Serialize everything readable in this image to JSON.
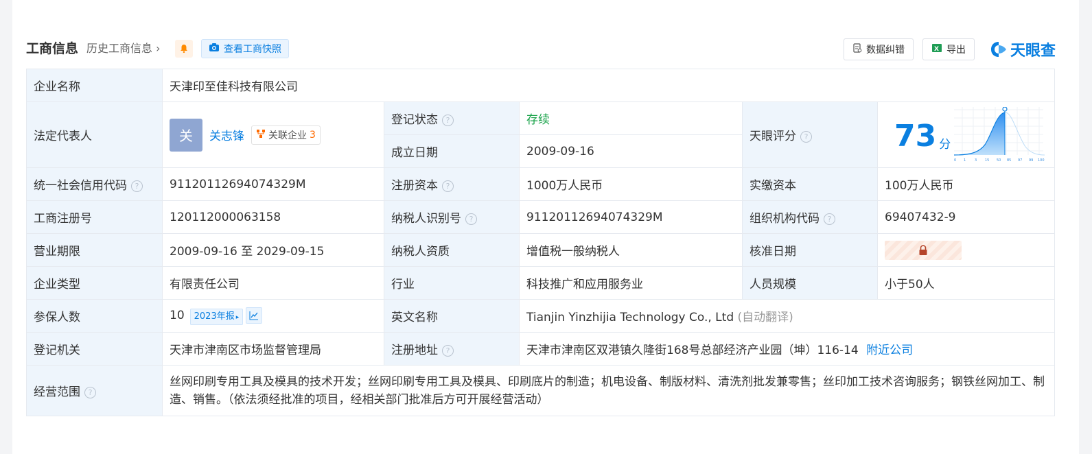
{
  "header": {
    "title": "工商信息",
    "history_link": "历史工商信息",
    "snapshot_button": "查看工商快照",
    "error_button": "数据纠错",
    "export_button": "导出",
    "logo_text": "天眼查"
  },
  "rows": {
    "company_name": {
      "label": "企业名称",
      "value": "天津印至佳科技有限公司"
    },
    "legal_rep": {
      "label": "法定代表人",
      "avatar_char": "关",
      "name": "关志锋",
      "related_label": "关联企业",
      "related_count": "3"
    },
    "reg_status": {
      "label": "登记状态",
      "value": "存续"
    },
    "established": {
      "label": "成立日期",
      "value": "2009-09-16"
    },
    "score": {
      "label": "天眼评分",
      "value": "73",
      "unit": "分",
      "axis_ticks": [
        "0",
        "1",
        "3",
        "15",
        "50",
        "85",
        "97",
        "99",
        "100"
      ]
    },
    "credit_code": {
      "label": "统一社会信用代码",
      "value": "91120112694074329M"
    },
    "reg_capital": {
      "label": "注册资本",
      "value": "1000万人民币"
    },
    "paid_capital": {
      "label": "实缴资本",
      "value": "100万人民币"
    },
    "reg_number": {
      "label": "工商注册号",
      "value": "120112000063158"
    },
    "taxpayer_id": {
      "label": "纳税人识别号",
      "value": "91120112694074329M"
    },
    "org_code": {
      "label": "组织机构代码",
      "value": "69407432-9"
    },
    "business_term": {
      "label": "营业期限",
      "value": "2009-09-16 至 2029-09-15"
    },
    "taxpayer_qual": {
      "label": "纳税人资质",
      "value": "增值税一般纳税人"
    },
    "approval_date": {
      "label": "核准日期"
    },
    "company_type": {
      "label": "企业类型",
      "value": "有限责任公司"
    },
    "industry": {
      "label": "行业",
      "value": "科技推广和应用服务业"
    },
    "staff_size": {
      "label": "人员规模",
      "value": "小于50人"
    },
    "insured": {
      "label": "参保人数",
      "value": "10",
      "report_tag": "2023年报"
    },
    "english_name": {
      "label": "英文名称",
      "value": "Tianjin Yinzhijia Technology Co., Ltd",
      "note": "(自动翻译)"
    },
    "reg_authority": {
      "label": "登记机关",
      "value": "天津市津南区市场监督管理局"
    },
    "reg_address": {
      "label": "注册地址",
      "value": "天津市津南区双港镇久隆街168号总部经济产业园（坤）116-14",
      "nearby_link": "附近公司"
    },
    "scope": {
      "label": "经营范围",
      "value": "丝网印刷专用工具及模具的技术开发；丝网印刷专用工具及模具、印刷底片的制造；机电设备、制版材料、清洗剂批发兼零售；丝印加工技术咨询服务；钢铁丝网加工、制造、销售。（依法须经批准的项目，经相关部门批准后方可开展经营活动）"
    }
  },
  "colors": {
    "accent": "#0a7fe0",
    "label_bg": "#eef5fc",
    "status_green": "#1aa34a"
  }
}
